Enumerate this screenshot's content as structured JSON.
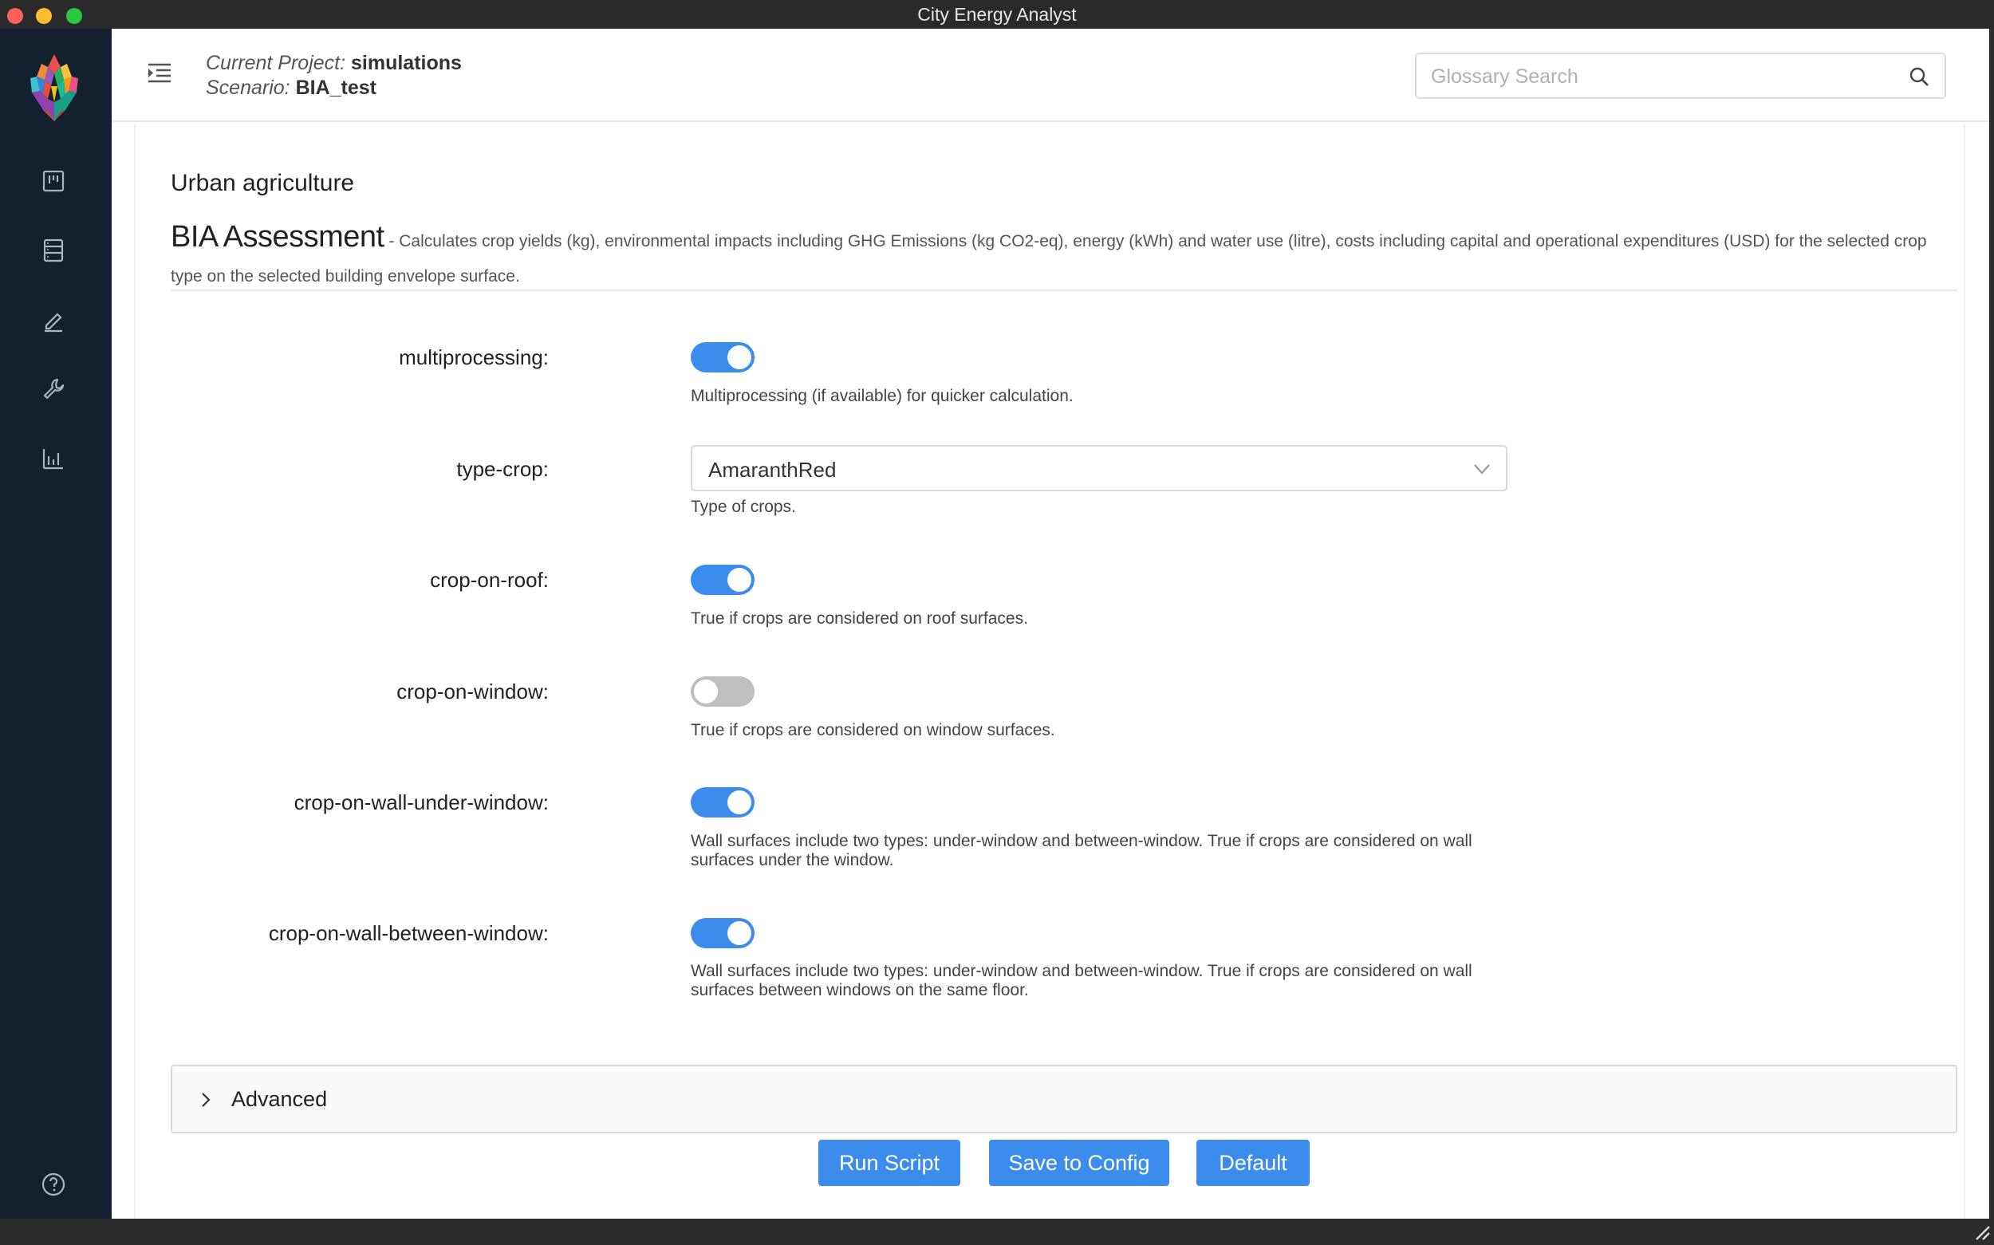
{
  "window": {
    "title": "City Energy Analyst"
  },
  "sidebar": {
    "items": [
      {
        "name": "project-overview-icon"
      },
      {
        "name": "input-database-icon"
      },
      {
        "name": "input-editor-icon"
      },
      {
        "name": "tools-icon"
      },
      {
        "name": "dashboard-icon"
      }
    ],
    "help_icon": "help-icon"
  },
  "header": {
    "project_prefix": "Current Project: ",
    "project_name": "simulations",
    "scenario_prefix": "Scenario: ",
    "scenario_name": "BIA_test",
    "search_placeholder": "Glossary Search"
  },
  "tool": {
    "category": "Urban agriculture",
    "name": "BIA Assessment",
    "description": "- Calculates crop yields (kg), environmental impacts including GHG Emissions (kg CO2-eq), energy (kWh) and water use (litre), costs including capital and operational expenditures (USD) for the selected crop type on the selected building envelope surface."
  },
  "parameters": [
    {
      "label": "multiprocessing",
      "type": "toggle",
      "value": true,
      "help": "Multiprocessing (if available) for quicker calculation."
    },
    {
      "label": "type-crop",
      "type": "select",
      "value": "AmaranthRed",
      "help": "Type of crops."
    },
    {
      "label": "crop-on-roof",
      "type": "toggle",
      "value": true,
      "help": "True if crops are considered on roof surfaces."
    },
    {
      "label": "crop-on-window",
      "type": "toggle",
      "value": false,
      "help": "True if crops are considered on window surfaces."
    },
    {
      "label": "crop-on-wall-under-window",
      "type": "toggle",
      "value": true,
      "help": "Wall surfaces include two types: under-window and between-window. True if crops are considered on wall surfaces under the window."
    },
    {
      "label": "crop-on-wall-between-window",
      "type": "toggle",
      "value": true,
      "help": "Wall surfaces include two types: under-window and between-window. True if crops are considered on wall surfaces between windows on the same floor."
    }
  ],
  "advanced": {
    "label": "Advanced"
  },
  "buttons": {
    "run": "Run Script",
    "save": "Save to Config",
    "default": "Default"
  },
  "colors": {
    "accent": "#3b8ced",
    "sidebar": "#13202f",
    "toggle_off": "#bfbfbf"
  }
}
